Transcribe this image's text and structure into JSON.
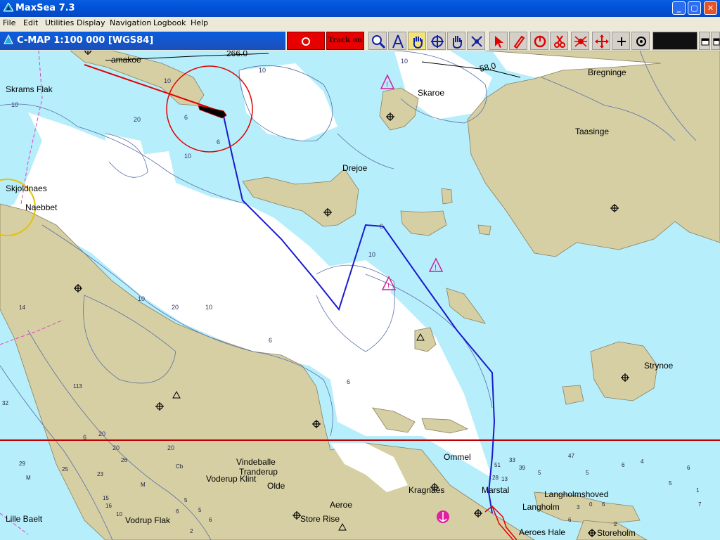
{
  "window": {
    "title": "MaxSea 7.3",
    "minimize": "_",
    "maximize": "▢",
    "close": "✕"
  },
  "menu": [
    "File",
    "Edit",
    "Utilities",
    "Display",
    "Navigation",
    "Logbook",
    "Help"
  ],
  "chart_header": {
    "title": "C-MAP  1:100 000 [WGS84]"
  },
  "toolbar": {
    "track_label": "Track on",
    "buttons": [
      "record",
      "track",
      "zoom",
      "route",
      "hand-move",
      "target",
      "hand-pan",
      "cross-marker",
      "pointer",
      "pencil",
      "undo",
      "scissors",
      "spider",
      "move-arrows",
      "plus",
      "circle-target",
      "dark-panel",
      "window-a",
      "window-b"
    ]
  },
  "map": {
    "colors": {
      "deep_water": "#ffffff",
      "shallow_water": "#b6eefb",
      "land": "#d6cfa3",
      "contour": "#5a6fa6",
      "track": "#1a1acd",
      "heading_line": "#e00000",
      "cursor_ring": "#e00000",
      "range_ring": "#e6c200",
      "border": "#e040c0"
    },
    "places": {
      "skrams_flak": "Skrams Flak",
      "bregninge": "Bregninge",
      "skaroe": "Skaroe",
      "taasinge": "Taasinge",
      "drejoe": "Drejoe",
      "skjoldnaes": "Skjoldnaes",
      "naebbet": "Naebbet",
      "strynoe": "Strynoe",
      "ommel": "Ommel",
      "marstal": "Marstal",
      "vindeballe": "Vindeballe",
      "tranderup": "Tranderup",
      "voderup_klint": "Voderup Klint",
      "olde": "Olde",
      "kragnaes": "Kragnaes",
      "aeroe": "Aeroe",
      "store_rise": "Store Rise",
      "lille_baelt": "Lille Baelt",
      "vodrup_flak": "Vodrup Flak",
      "langholmshoved": "Langholmshoved",
      "langholm": "Langholm",
      "aeroes_hale": "Aeroes Hale",
      "storeholm": "Storeholm",
      "unnamed_top": "amakoe"
    },
    "bearings": {
      "left": "266.0",
      "right": "58.0"
    },
    "contour_labels": [
      "10",
      "10",
      "10",
      "6",
      "6",
      "6",
      "20",
      "20",
      "10",
      "10",
      "20",
      "10",
      "6",
      "6",
      "10",
      "10",
      "20",
      "20",
      "6"
    ],
    "soundings": [
      "14",
      "113",
      "32",
      "29",
      "25",
      "23",
      "26",
      "M",
      "M",
      "15",
      "16",
      "10",
      "6",
      "5",
      "5",
      "6",
      "2",
      "Cb",
      "33",
      "51",
      "39",
      "47",
      "28",
      "13",
      "5",
      "6",
      "4",
      "5",
      "1",
      "6",
      "2",
      "6",
      "3",
      "5",
      "0",
      "6",
      "7"
    ]
  }
}
